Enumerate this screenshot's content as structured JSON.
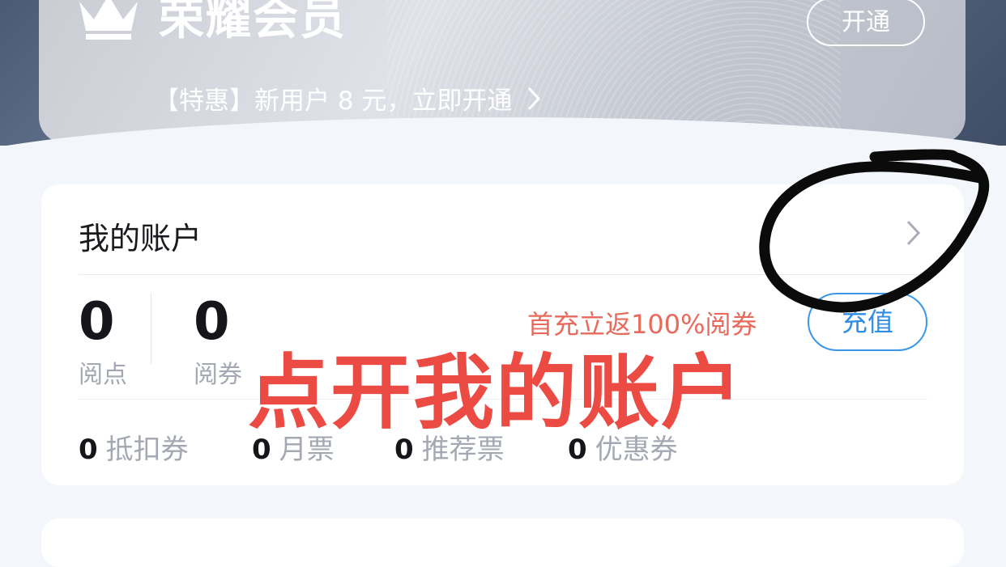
{
  "vip": {
    "title": "荣耀会员",
    "open_label": "开通",
    "promo": "【特惠】新用户 8 元，立即开通"
  },
  "account": {
    "title": "我的账户",
    "stats": [
      {
        "value": "0",
        "label": "阅点"
      },
      {
        "value": "0",
        "label": "阅券"
      }
    ],
    "recharge_promo": "首充立返100%阅券",
    "recharge_label": "充值",
    "coupons": [
      {
        "value": "0",
        "label": "抵扣券"
      },
      {
        "value": "0",
        "label": "月票"
      },
      {
        "value": "0",
        "label": "推荐票"
      },
      {
        "value": "0",
        "label": "优惠券"
      }
    ]
  },
  "annotation": {
    "text": "点开我的账户"
  },
  "icons": {
    "crown": "crown-icon",
    "chevron": "chevron-right-icon"
  },
  "colors": {
    "recharge_blue": "#2f8de4",
    "annotation_red": "#ec4b43",
    "promo_red": "#e86a5d"
  }
}
